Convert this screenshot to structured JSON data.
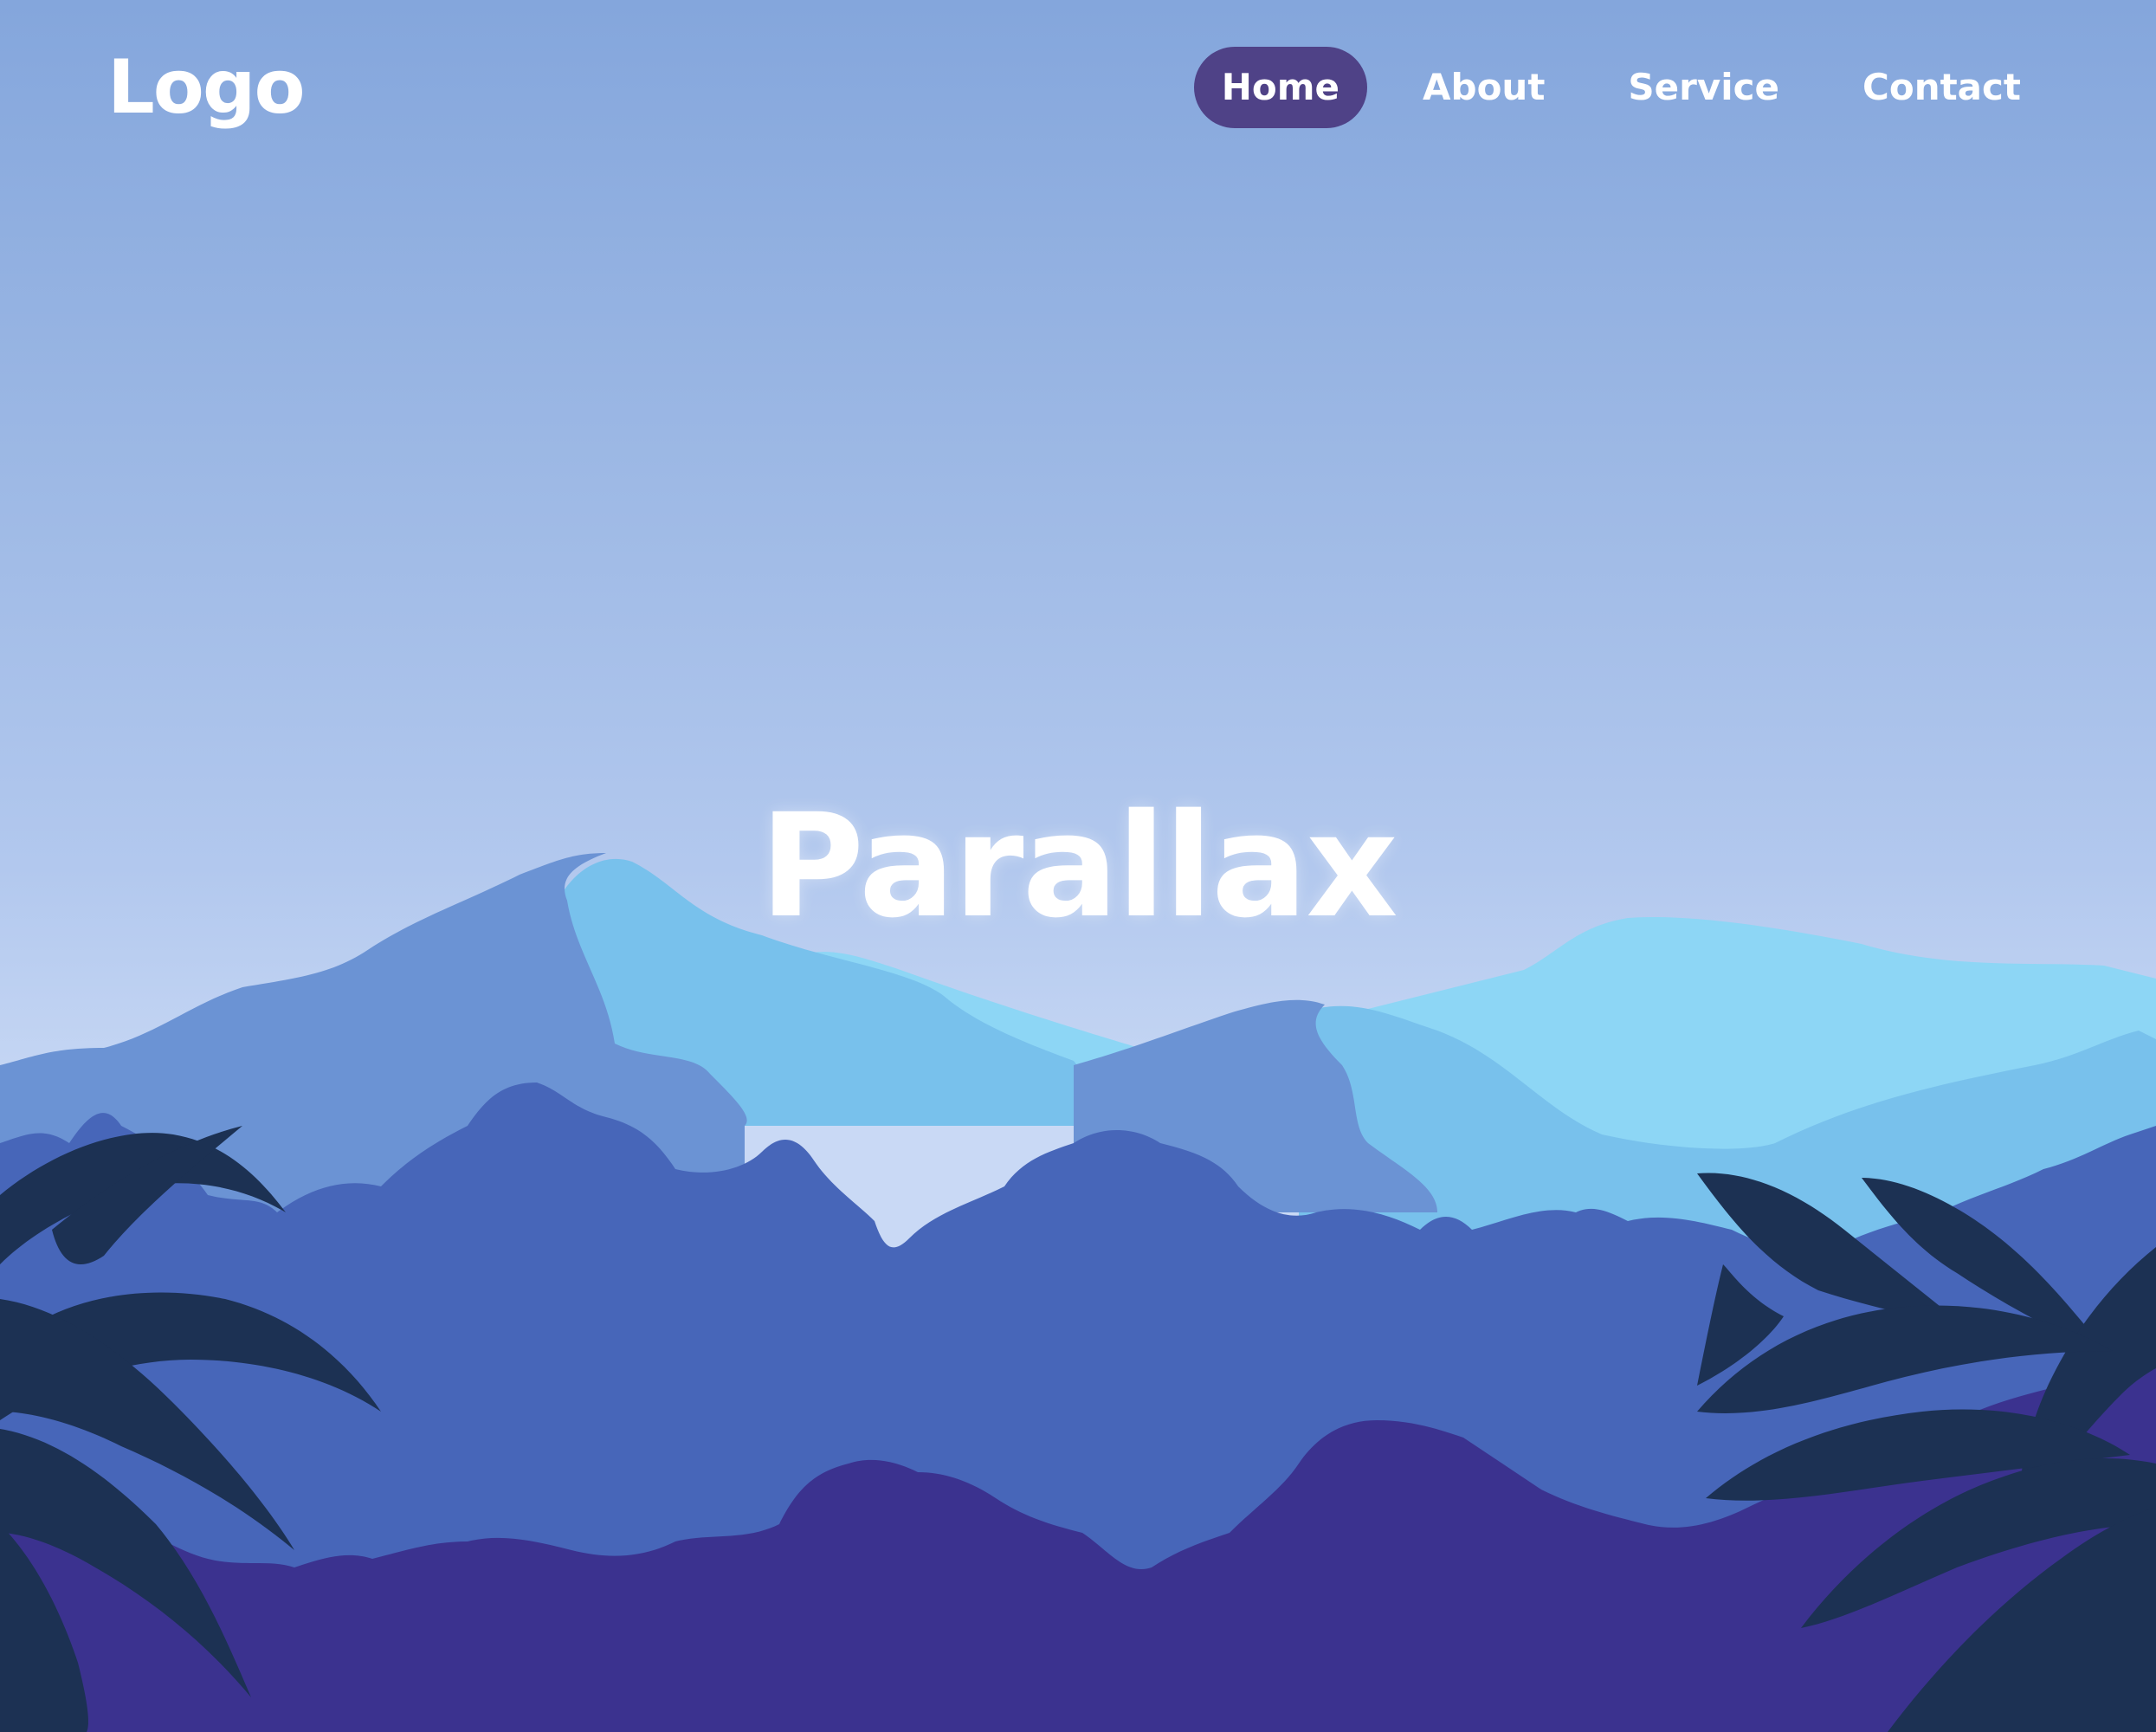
{
  "logo": {
    "text": "Logo"
  },
  "nav": {
    "items": [
      {
        "label": "Home",
        "active": true
      },
      {
        "label": "About",
        "active": false
      },
      {
        "label": "Service",
        "active": false
      },
      {
        "label": "Contact",
        "active": false
      }
    ]
  },
  "hero": {
    "title": "Parallax"
  },
  "colors": {
    "sky_top": "#84a6dc",
    "sky_bottom": "#c9d9f5",
    "mountain_far": "#8dd6f5",
    "mountain_mid_light": "#78c1ec",
    "mountain_mid_dark": "#6b93d4",
    "foliage_mid": "#4766b9",
    "foliage_front": "#3b328f",
    "leaves": "#1c3153",
    "nav_active": "#4f4287",
    "text": "#ffffff"
  }
}
